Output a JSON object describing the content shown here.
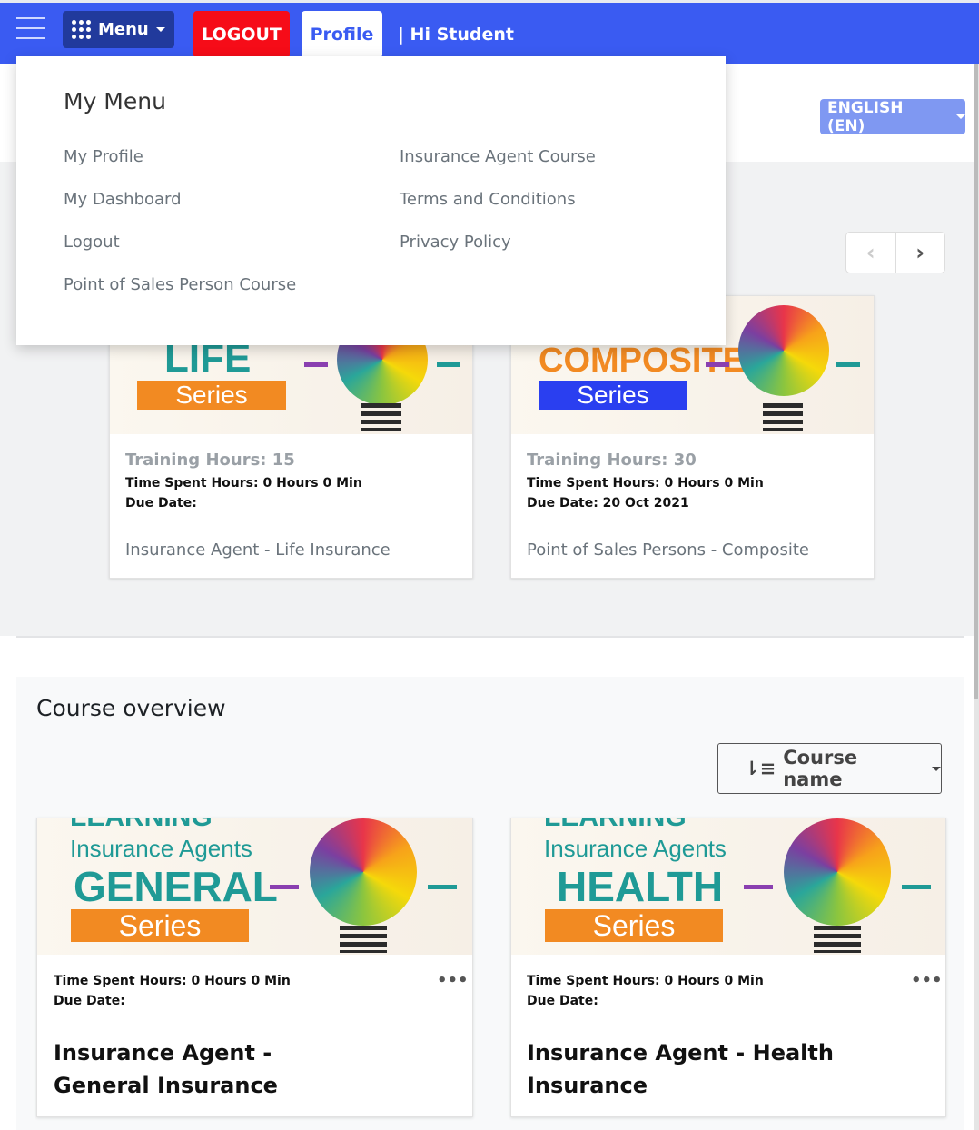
{
  "header": {
    "menu_label": "Menu",
    "logout_label": "LOGOUT",
    "profile_label": "Profile",
    "greeting": "| Hi Student"
  },
  "language": {
    "selected": "ENGLISH (EN)"
  },
  "my_menu": {
    "title": "My Menu",
    "items": [
      {
        "label": "My Profile"
      },
      {
        "label": "My Dashboard"
      },
      {
        "label": "Logout"
      },
      {
        "label": "Point of Sales Person Course"
      },
      {
        "label": "Insurance Agent Course"
      },
      {
        "label": "Terms and Conditions"
      },
      {
        "label": "Privacy Policy"
      }
    ]
  },
  "carousel": {
    "cards": [
      {
        "image_title": "LIFE",
        "image_band": "Series",
        "training_hours": "Training Hours: 15",
        "time_spent": "Time Spent Hours: 0 Hours 0 Min",
        "due_date": "Due Date:",
        "name": "Insurance Agent - Life Insurance"
      },
      {
        "image_title": "COMPOSITE",
        "image_band": "Series",
        "training_hours": "Training Hours: 30",
        "time_spent": "Time Spent Hours: 0 Hours 0 Min",
        "due_date": "Due Date: 20 Oct 2021",
        "name": "Point of Sales Persons - Composite"
      }
    ]
  },
  "course_overview": {
    "title": "Course overview",
    "sort_label": "Course name",
    "cards": [
      {
        "image_top": "LEARNING",
        "image_sub": "Insurance Agents",
        "image_title": "GENERAL",
        "image_band": "Series",
        "time_spent": "Time Spent Hours: 0 Hours 0 Min",
        "due_date": "Due Date:",
        "name": "Insurance Agent - General Insurance"
      },
      {
        "image_top": "LEARNING",
        "image_sub": "Insurance Agents",
        "image_title": "HEALTH",
        "image_band": "Series",
        "time_spent": "Time Spent Hours: 0 Hours 0 Min",
        "due_date": "Due Date:",
        "name": "Insurance Agent - Health Insurance"
      }
    ]
  },
  "colors": {
    "header": "#3a5bf2",
    "logout": "#f60c18",
    "teal": "#1f9a96",
    "orange": "#f28a22",
    "blue_band": "#2a3ff0"
  }
}
